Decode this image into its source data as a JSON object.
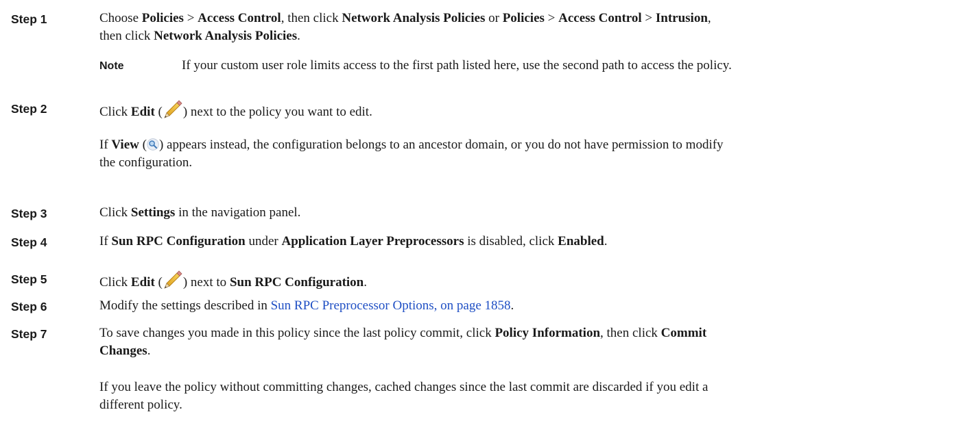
{
  "steps": [
    {
      "label": "Step 1",
      "seg": [
        "Choose ",
        "Policies",
        " > ",
        "Access Control",
        ", then click ",
        "Network Analysis Policies",
        " or ",
        "Policies",
        "  > ",
        "Access Control",
        " > ",
        "Intrusion",
        ",",
        "then click ",
        "Network Analysis Policies",
        "."
      ],
      "note": {
        "label": "Note",
        "text": "If your custom user role limits access to the first path listed here, use the second path to access the policy."
      }
    },
    {
      "label": "Step 2",
      "seg": [
        "Click ",
        "Edit",
        " (",
        ") next to the policy you want to edit."
      ],
      "p2": [
        "If ",
        "View",
        " (",
        ") appears instead, the configuration belongs to an ancestor domain, or you do not have permission to modify",
        "the configuration."
      ]
    },
    {
      "label": "Step 3",
      "seg": [
        "Click ",
        "Settings",
        " in the navigation panel."
      ]
    },
    {
      "label": "Step 4",
      "seg": [
        "If ",
        "Sun RPC Configuration",
        " under ",
        "Application Layer Preprocessors",
        " is disabled, click ",
        "Enabled",
        "."
      ]
    },
    {
      "label": "Step 5",
      "seg": [
        "Click ",
        "Edit",
        " (",
        ") next to ",
        "Sun RPC Configuration",
        "."
      ]
    },
    {
      "label": "Step 6",
      "seg": [
        "Modify the settings described in ",
        "Sun RPC Preprocessor Options, on page 1858",
        "."
      ]
    },
    {
      "label": "Step 7",
      "seg": [
        "To save changes you made in this policy since the last policy commit, click ",
        "Policy Information",
        ", then click ",
        "Commit",
        "Changes",
        "."
      ],
      "p2": [
        "If you leave the policy without committing changes, cached changes since the last commit are discarded if you edit a",
        "different policy."
      ]
    }
  ],
  "icons": {
    "edit": "pencil-icon",
    "view": "magnifier-icon"
  }
}
